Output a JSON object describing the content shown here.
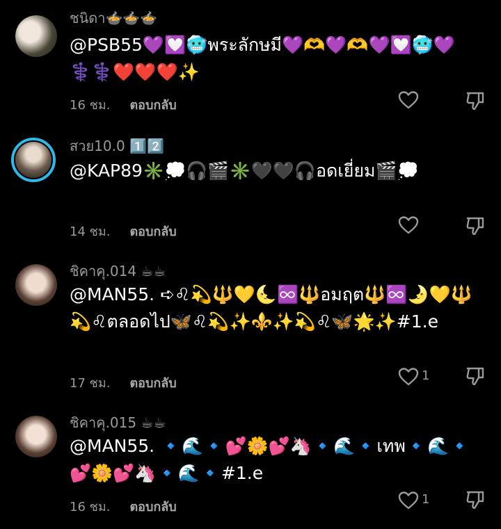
{
  "comments": [
    {
      "username": "ชนิดา🍲🍲🍲",
      "text": "@PSB55💜💟🥶พระลักษมี💜🫶💜🫶💜💟🥶💜⚕️⚕️❤️❤️❤️✨",
      "time": "16 ชม.",
      "reply": "ตอบกลับ",
      "likes": "",
      "avatar_colors": [
        "#d8cfc2",
        "#3b3b2e"
      ]
    },
    {
      "username": "สวย10.0 1️⃣2️⃣",
      "text": "@KAP89✳️💭🎧🎬✳️🖤🖤🎧อดเยี่ยม🎬💭",
      "time": "14 ชม.",
      "reply": "ตอบกลับ",
      "likes": "",
      "avatar_colors": [
        "#d9c7b8",
        "#2a2a2a"
      ]
    },
    {
      "username": "ชิคาคุ.014 ☕☕",
      "text": "@MAN55. ➪♌💫🔱💛🌜♾️🔱อมฤต🔱♾️🌛💛🔱💫♌ตลอดไป🦋♌💫✨⚜️✨💫♌🦋🌟✨#1.e",
      "time": "17 ชม.",
      "reply": "ตอบกลับ",
      "likes": "1",
      "avatar_colors": [
        "#e6cbbd",
        "#3a2a22"
      ]
    },
    {
      "username": "ชิคาคุ.015 ☕☕",
      "text": "@MAN55. 🔹🌊🔹💕🌼💕🦄🔹🌊🔹เทพ🔹🌊🔹💕🌼💕🦄🔹🌊🔹#1.e",
      "time": "16 ชม.",
      "reply": "ตอบกลับ",
      "likes": "1",
      "avatar_colors": [
        "#ead2c6",
        "#3a2a22"
      ]
    }
  ]
}
